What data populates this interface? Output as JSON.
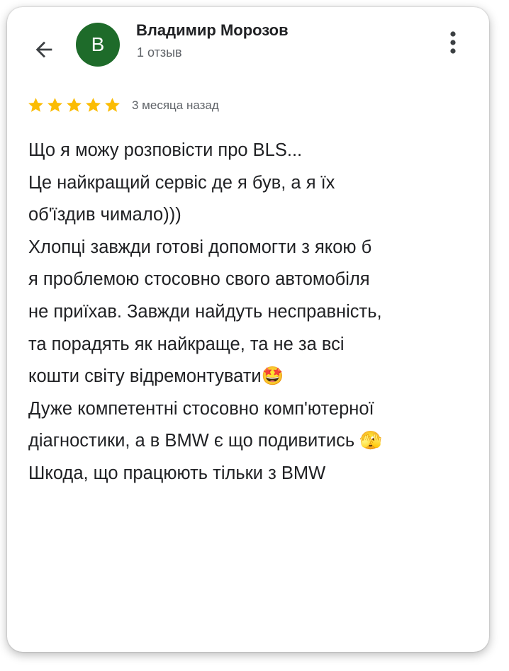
{
  "reviewer": {
    "avatar_letter": "В",
    "avatar_color": "#1e6b2a",
    "name": "Владимир Морозов",
    "meta": "1 отзыв"
  },
  "icons": {
    "back": "arrow-left-icon",
    "more": "more-vertical-icon",
    "star": "star-icon"
  },
  "review": {
    "rating": 5,
    "rating_max": 5,
    "star_color": "#fbbc04",
    "date": "3 месяца назад",
    "lines": [
      "Що я можу розповісти про BLS...",
      "Це найкращий сервіс де я був, а я їх",
      "об'їздив чимало)))",
      "Хлопці завжди готові допомогти з якою б",
      "я проблемою стосовно свого автомобіля",
      "не приїхав. Завжди найдуть несправність,",
      "та порадять як найкраще, та не за всі",
      "кошти світу відремонтувати🤩",
      "Дуже компетентні стосовно комп'ютерної",
      "діагностики, а в BMW є що подивитись 🫣",
      "Шкода, що працюють тільки з BMW"
    ]
  }
}
